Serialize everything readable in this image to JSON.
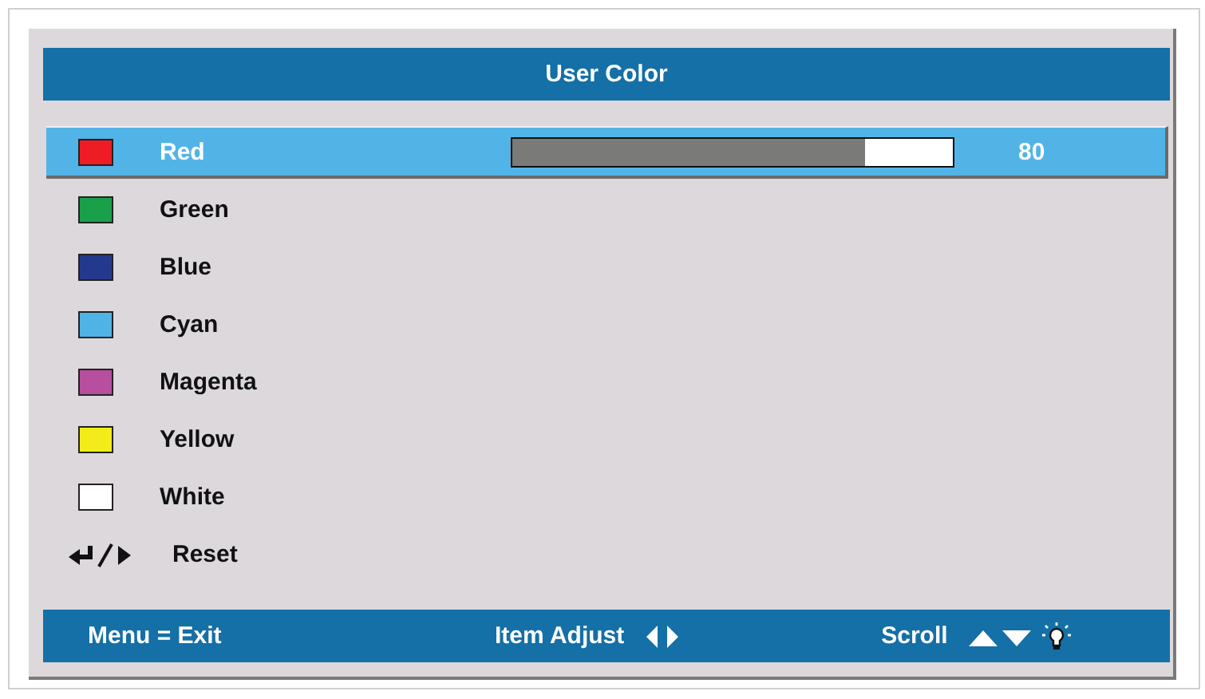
{
  "title": "User Color",
  "items": [
    {
      "kind": "color",
      "label": "Red",
      "color": "#ee1c25",
      "selected": true,
      "level": 0.8,
      "reading": "80"
    },
    {
      "kind": "color",
      "label": "Green",
      "color": "#1aa04a",
      "selected": false
    },
    {
      "kind": "color",
      "label": "Blue",
      "color": "#233a8c",
      "selected": false
    },
    {
      "kind": "color",
      "label": "Cyan",
      "color": "#4fb3e6",
      "selected": false
    },
    {
      "kind": "color",
      "label": "Magenta",
      "color": "#b84e9e",
      "selected": false
    },
    {
      "kind": "color",
      "label": "Yellow",
      "color": "#f4ec1a",
      "selected": false
    },
    {
      "kind": "color",
      "label": "White",
      "color": "#ffffff",
      "selected": false
    },
    {
      "kind": "reset",
      "label": "Reset",
      "selected": false
    }
  ],
  "footer": {
    "exit": "Menu = Exit",
    "adjust": "Item Adjust",
    "scroll": "Scroll"
  }
}
